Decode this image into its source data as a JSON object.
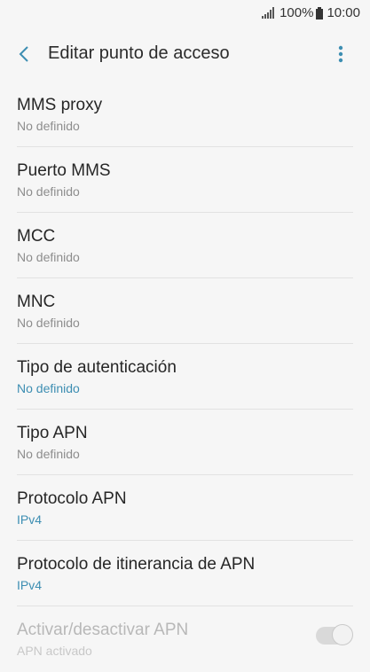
{
  "status_bar": {
    "battery_level": "100%",
    "time": "10:00"
  },
  "app_bar": {
    "title": "Editar punto de acceso"
  },
  "settings": [
    {
      "title": "MMS proxy",
      "value": "No definido",
      "value_accent": false
    },
    {
      "title": "Puerto MMS",
      "value": "No definido",
      "value_accent": false
    },
    {
      "title": "MCC",
      "value": "No definido",
      "value_accent": false
    },
    {
      "title": "MNC",
      "value": "No definido",
      "value_accent": false
    },
    {
      "title": "Tipo de autenticación",
      "value": "No definido",
      "value_accent": true
    },
    {
      "title": "Tipo APN",
      "value": "No definido",
      "value_accent": false
    },
    {
      "title": "Protocolo APN",
      "value": "IPv4",
      "value_accent": true
    },
    {
      "title": "Protocolo de itinerancia de APN",
      "value": "IPv4",
      "value_accent": true
    },
    {
      "title": "Activar/desactivar APN",
      "value": "APN activado",
      "value_accent": false,
      "disabled": true,
      "toggle_on": true
    }
  ],
  "colors": {
    "background": "#f6f6f6",
    "accent": "#3d8eb2",
    "back_icon": "#3d8eb2",
    "more_icon": "#3d8eb2"
  }
}
